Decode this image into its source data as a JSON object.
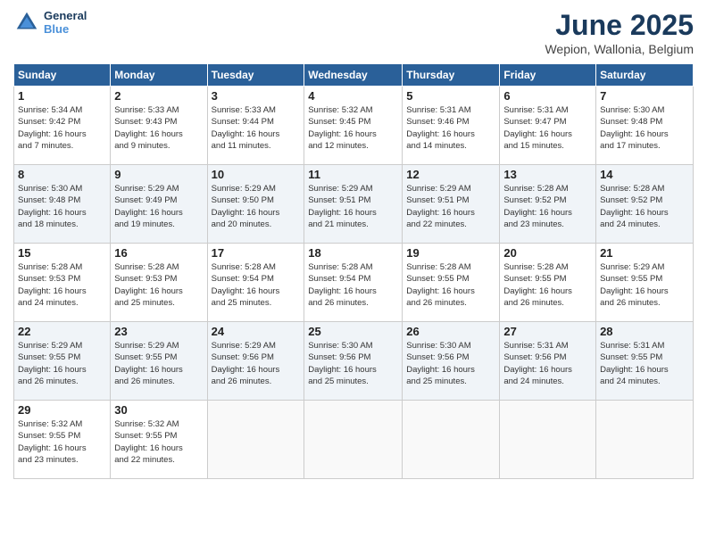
{
  "header": {
    "logo_general": "General",
    "logo_blue": "Blue",
    "title": "June 2025",
    "location": "Wepion, Wallonia, Belgium"
  },
  "calendar": {
    "days_of_week": [
      "Sunday",
      "Monday",
      "Tuesday",
      "Wednesday",
      "Thursday",
      "Friday",
      "Saturday"
    ],
    "weeks": [
      [
        {
          "day": "",
          "info": ""
        },
        {
          "day": "2",
          "info": "Sunrise: 5:33 AM\nSunset: 9:43 PM\nDaylight: 16 hours\nand 9 minutes."
        },
        {
          "day": "3",
          "info": "Sunrise: 5:33 AM\nSunset: 9:44 PM\nDaylight: 16 hours\nand 11 minutes."
        },
        {
          "day": "4",
          "info": "Sunrise: 5:32 AM\nSunset: 9:45 PM\nDaylight: 16 hours\nand 12 minutes."
        },
        {
          "day": "5",
          "info": "Sunrise: 5:31 AM\nSunset: 9:46 PM\nDaylight: 16 hours\nand 14 minutes."
        },
        {
          "day": "6",
          "info": "Sunrise: 5:31 AM\nSunset: 9:47 PM\nDaylight: 16 hours\nand 15 minutes."
        },
        {
          "day": "7",
          "info": "Sunrise: 5:30 AM\nSunset: 9:48 PM\nDaylight: 16 hours\nand 17 minutes."
        }
      ],
      [
        {
          "day": "1",
          "info": "Sunrise: 5:34 AM\nSunset: 9:42 PM\nDaylight: 16 hours\nand 7 minutes."
        },
        {
          "day": "",
          "info": ""
        },
        {
          "day": "",
          "info": ""
        },
        {
          "day": "",
          "info": ""
        },
        {
          "day": "",
          "info": ""
        },
        {
          "day": "",
          "info": ""
        },
        {
          "day": "",
          "info": ""
        }
      ],
      [
        {
          "day": "8",
          "info": "Sunrise: 5:30 AM\nSunset: 9:48 PM\nDaylight: 16 hours\nand 18 minutes."
        },
        {
          "day": "9",
          "info": "Sunrise: 5:29 AM\nSunset: 9:49 PM\nDaylight: 16 hours\nand 19 minutes."
        },
        {
          "day": "10",
          "info": "Sunrise: 5:29 AM\nSunset: 9:50 PM\nDaylight: 16 hours\nand 20 minutes."
        },
        {
          "day": "11",
          "info": "Sunrise: 5:29 AM\nSunset: 9:51 PM\nDaylight: 16 hours\nand 21 minutes."
        },
        {
          "day": "12",
          "info": "Sunrise: 5:29 AM\nSunset: 9:51 PM\nDaylight: 16 hours\nand 22 minutes."
        },
        {
          "day": "13",
          "info": "Sunrise: 5:28 AM\nSunset: 9:52 PM\nDaylight: 16 hours\nand 23 minutes."
        },
        {
          "day": "14",
          "info": "Sunrise: 5:28 AM\nSunset: 9:52 PM\nDaylight: 16 hours\nand 24 minutes."
        }
      ],
      [
        {
          "day": "15",
          "info": "Sunrise: 5:28 AM\nSunset: 9:53 PM\nDaylight: 16 hours\nand 24 minutes."
        },
        {
          "day": "16",
          "info": "Sunrise: 5:28 AM\nSunset: 9:53 PM\nDaylight: 16 hours\nand 25 minutes."
        },
        {
          "day": "17",
          "info": "Sunrise: 5:28 AM\nSunset: 9:54 PM\nDaylight: 16 hours\nand 25 minutes."
        },
        {
          "day": "18",
          "info": "Sunrise: 5:28 AM\nSunset: 9:54 PM\nDaylight: 16 hours\nand 26 minutes."
        },
        {
          "day": "19",
          "info": "Sunrise: 5:28 AM\nSunset: 9:55 PM\nDaylight: 16 hours\nand 26 minutes."
        },
        {
          "day": "20",
          "info": "Sunrise: 5:28 AM\nSunset: 9:55 PM\nDaylight: 16 hours\nand 26 minutes."
        },
        {
          "day": "21",
          "info": "Sunrise: 5:29 AM\nSunset: 9:55 PM\nDaylight: 16 hours\nand 26 minutes."
        }
      ],
      [
        {
          "day": "22",
          "info": "Sunrise: 5:29 AM\nSunset: 9:55 PM\nDaylight: 16 hours\nand 26 minutes."
        },
        {
          "day": "23",
          "info": "Sunrise: 5:29 AM\nSunset: 9:55 PM\nDaylight: 16 hours\nand 26 minutes."
        },
        {
          "day": "24",
          "info": "Sunrise: 5:29 AM\nSunset: 9:56 PM\nDaylight: 16 hours\nand 26 minutes."
        },
        {
          "day": "25",
          "info": "Sunrise: 5:30 AM\nSunset: 9:56 PM\nDaylight: 16 hours\nand 25 minutes."
        },
        {
          "day": "26",
          "info": "Sunrise: 5:30 AM\nSunset: 9:56 PM\nDaylight: 16 hours\nand 25 minutes."
        },
        {
          "day": "27",
          "info": "Sunrise: 5:31 AM\nSunset: 9:56 PM\nDaylight: 16 hours\nand 24 minutes."
        },
        {
          "day": "28",
          "info": "Sunrise: 5:31 AM\nSunset: 9:55 PM\nDaylight: 16 hours\nand 24 minutes."
        }
      ],
      [
        {
          "day": "29",
          "info": "Sunrise: 5:32 AM\nSunset: 9:55 PM\nDaylight: 16 hours\nand 23 minutes."
        },
        {
          "day": "30",
          "info": "Sunrise: 5:32 AM\nSunset: 9:55 PM\nDaylight: 16 hours\nand 22 minutes."
        },
        {
          "day": "",
          "info": ""
        },
        {
          "day": "",
          "info": ""
        },
        {
          "day": "",
          "info": ""
        },
        {
          "day": "",
          "info": ""
        },
        {
          "day": "",
          "info": ""
        }
      ]
    ]
  }
}
